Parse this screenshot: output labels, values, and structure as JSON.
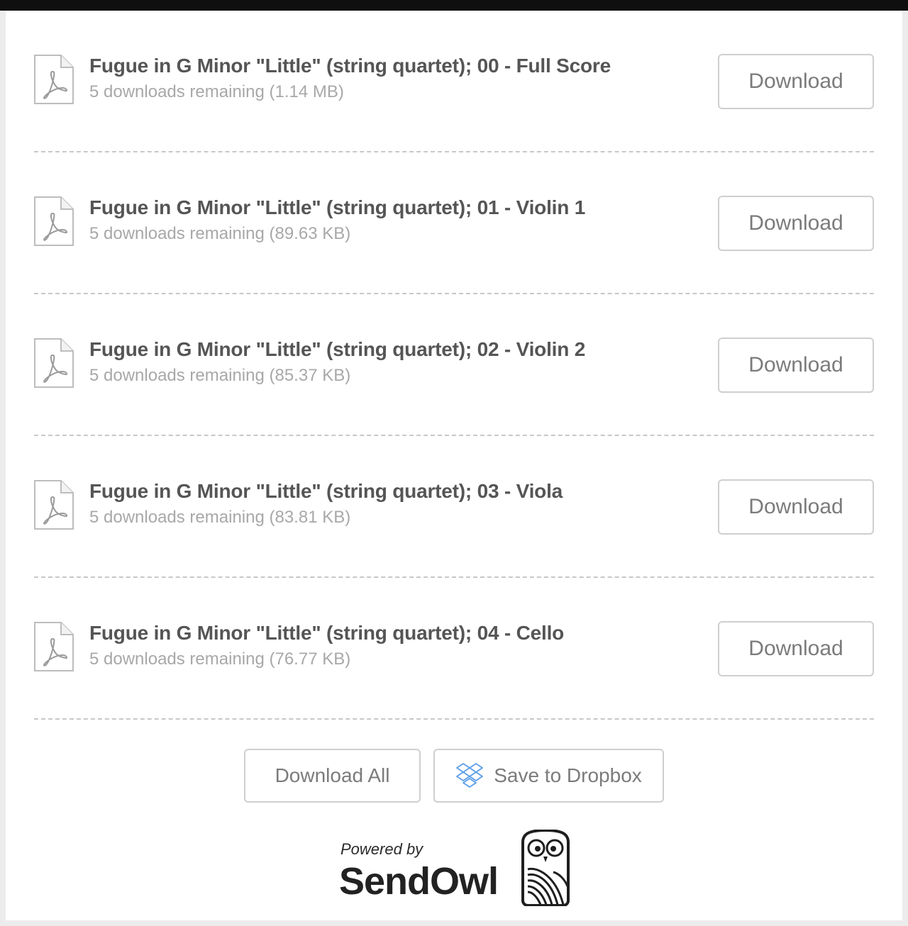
{
  "files": [
    {
      "title": "Fugue in G Minor \"Little\" (string quartet); 00 - Full Score",
      "meta": "5 downloads remaining (1.14 MB)",
      "button": "Download",
      "icon": "pdf-file-icon"
    },
    {
      "title": "Fugue in G Minor \"Little\" (string quartet); 01 - Violin 1",
      "meta": "5 downloads remaining (89.63 KB)",
      "button": "Download",
      "icon": "pdf-file-icon"
    },
    {
      "title": "Fugue in G Minor \"Little\" (string quartet); 02 - Violin 2",
      "meta": "5 downloads remaining (85.37 KB)",
      "button": "Download",
      "icon": "pdf-file-icon"
    },
    {
      "title": "Fugue in G Minor \"Little\" (string quartet); 03 - Viola",
      "meta": "5 downloads remaining (83.81 KB)",
      "button": "Download",
      "icon": "pdf-file-icon"
    },
    {
      "title": "Fugue in G Minor \"Little\" (string quartet); 04 - Cello",
      "meta": "5 downloads remaining (76.77 KB)",
      "button": "Download",
      "icon": "pdf-file-icon"
    }
  ],
  "actions": {
    "download_all": "Download All",
    "save_dropbox": "Save to Dropbox",
    "dropbox_icon": "dropbox-icon",
    "dropbox_color": "#5b9ee8"
  },
  "footer": {
    "powered_by": "Powered by",
    "brand": "SendOwl",
    "logo_icon": "owl-icon"
  }
}
